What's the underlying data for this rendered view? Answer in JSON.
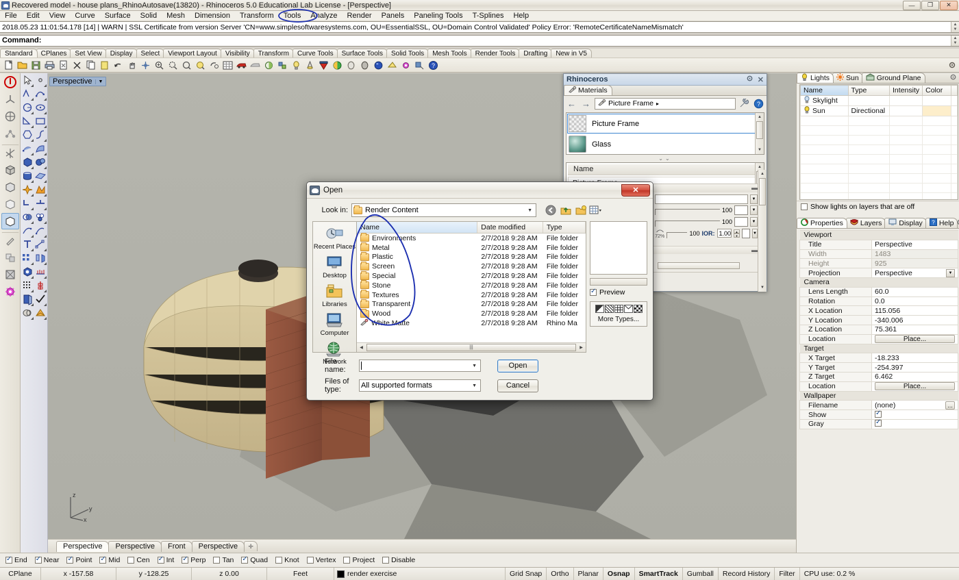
{
  "window": {
    "title": "Recovered model - house plans_RhinoAutosave(13820) - Rhinoceros 5.0 Educational Lab License - [Perspective]",
    "minimize": "—",
    "maximize": "❐",
    "close": "✕"
  },
  "menubar": {
    "items": [
      "File",
      "Edit",
      "View",
      "Curve",
      "Surface",
      "Solid",
      "Mesh",
      "Dimension",
      "Transform",
      "Tools",
      "Analyze",
      "Render",
      "Panels",
      "Paneling Tools",
      "T-Splines",
      "Help"
    ]
  },
  "warning": {
    "text": "2018.05.23 11:01:54.178 [14] | WARN | SSL Certificate from version Server 'CN=www.simplesoftwaresystems.com, OU=EssentialSSL, OU=Domain Control Validated' Policy Error: 'RemoteCertificateNameMismatch'"
  },
  "command": {
    "prompt": "Command:",
    "value": ""
  },
  "toolbar_tabs": {
    "items": [
      "Standard",
      "CPlanes",
      "Set View",
      "Display",
      "Select",
      "Viewport Layout",
      "Visibility",
      "Transform",
      "Curve Tools",
      "Surface Tools",
      "Solid Tools",
      "Mesh Tools",
      "Render Tools",
      "Drafting",
      "New in V5"
    ],
    "active": "Standard"
  },
  "viewport": {
    "label": "Perspective",
    "axis_x": "x",
    "axis_y": "y",
    "axis_z": "z",
    "tabs": [
      "Perspective",
      "Perspective",
      "Front",
      "Perspective"
    ],
    "active_tab_index": 0,
    "add_tab": "✛"
  },
  "materials_panel": {
    "title": "Rhinoceros",
    "gear": "gear-icon",
    "close": "✕",
    "tab": "Materials",
    "back": "←",
    "forward": "→",
    "path": "Picture Frame",
    "path_chevron": "▸",
    "wrench": "wrench-icon",
    "help": "?",
    "list": [
      {
        "name": "Picture Frame",
        "selected": true,
        "swatch": "checker"
      },
      {
        "name": "Glass",
        "selected": false,
        "swatch": "glass-sphere"
      }
    ],
    "name_header": "Name",
    "name_value": "Picture Frame",
    "sliders": [
      {
        "value": "100"
      },
      {
        "value": "100"
      }
    ],
    "transparency_percent": "72%",
    "transparency_value": "100",
    "ior_label": "IOR:",
    "ior_value": "1.00"
  },
  "open_dialog": {
    "title": "Open",
    "close": "✕",
    "look_in_label": "Look in:",
    "look_in_value": "Render Content",
    "nav_icons": [
      "back-icon",
      "up-folder-icon",
      "new-folder-icon",
      "view-mode-icon"
    ],
    "places": [
      {
        "label": "Recent Places",
        "icon": "recent-places-icon"
      },
      {
        "label": "Desktop",
        "icon": "desktop-icon"
      },
      {
        "label": "Libraries",
        "icon": "libraries-icon"
      },
      {
        "label": "Computer",
        "icon": "computer-icon"
      },
      {
        "label": "Network",
        "icon": "network-icon"
      }
    ],
    "columns": [
      "Name",
      "Date modified",
      "Type"
    ],
    "files": [
      {
        "name": "Environments",
        "date": "2/7/2018 9:28 AM",
        "type": "File folder",
        "kind": "folder"
      },
      {
        "name": "Metal",
        "date": "2/7/2018 9:28 AM",
        "type": "File folder",
        "kind": "folder"
      },
      {
        "name": "Plastic",
        "date": "2/7/2018 9:28 AM",
        "type": "File folder",
        "kind": "folder"
      },
      {
        "name": "Screen",
        "date": "2/7/2018 9:28 AM",
        "type": "File folder",
        "kind": "folder"
      },
      {
        "name": "Special",
        "date": "2/7/2018 9:28 AM",
        "type": "File folder",
        "kind": "folder"
      },
      {
        "name": "Stone",
        "date": "2/7/2018 9:28 AM",
        "type": "File folder",
        "kind": "folder"
      },
      {
        "name": "Textures",
        "date": "2/7/2018 9:28 AM",
        "type": "File folder",
        "kind": "folder"
      },
      {
        "name": "Transparent",
        "date": "2/7/2018 9:28 AM",
        "type": "File folder",
        "kind": "folder"
      },
      {
        "name": "Wood",
        "date": "2/7/2018 9:28 AM",
        "type": "File folder",
        "kind": "folder"
      },
      {
        "name": "White Matte",
        "date": "2/7/2018 9:28 AM",
        "type": "Rhino Ma",
        "kind": "material"
      }
    ],
    "preview_label": "Preview",
    "preview_checked": true,
    "more_types": "More Types...",
    "filename_label": "File name:",
    "filename_value": "",
    "filetype_label": "Files of type:",
    "filetype_value": "All supported formats",
    "open_button": "Open",
    "cancel_button": "Cancel"
  },
  "lights_panel": {
    "tabs": [
      {
        "label": "Lights",
        "icon": "lightbulb-icon",
        "active": true
      },
      {
        "label": "Sun",
        "icon": "sun-icon",
        "active": false
      },
      {
        "label": "Ground Plane",
        "icon": "ground-plane-icon",
        "active": false
      }
    ],
    "gear": "gear-icon",
    "columns": [
      "Name",
      "Type",
      "Intensity",
      "Color"
    ],
    "rows": [
      {
        "name": "Skylight",
        "type": "",
        "intensity": "",
        "color": "",
        "icon": "skylight-icon"
      },
      {
        "name": "Sun",
        "type": "Directional",
        "intensity": "",
        "color": "#fdeecb",
        "icon": "sun-bulb-icon"
      }
    ],
    "footer_checkbox": "Show lights on layers that are off",
    "footer_checked": false
  },
  "properties_panel": {
    "tabs": [
      {
        "label": "Properties",
        "icon": "properties-icon",
        "active": true
      },
      {
        "label": "Layers",
        "icon": "layers-icon",
        "active": false
      },
      {
        "label": "Display",
        "icon": "display-icon",
        "active": false
      },
      {
        "label": "Help",
        "icon": "help-icon",
        "active": false
      }
    ],
    "gear": "gear-icon",
    "groups": [
      {
        "title": "Viewport",
        "rows": [
          {
            "label": "Title",
            "value": "Perspective",
            "dim": false,
            "kind": "text"
          },
          {
            "label": "Width",
            "value": "1483",
            "dim": true,
            "kind": "text"
          },
          {
            "label": "Height",
            "value": "925",
            "dim": true,
            "kind": "text"
          },
          {
            "label": "Projection",
            "value": "Perspective",
            "dim": false,
            "kind": "dropdown"
          }
        ]
      },
      {
        "title": "Camera",
        "rows": [
          {
            "label": "Lens Length",
            "value": "60.0",
            "dim": false,
            "kind": "text"
          },
          {
            "label": "Rotation",
            "value": "0.0",
            "dim": false,
            "kind": "text"
          },
          {
            "label": "X Location",
            "value": "115.056",
            "dim": false,
            "kind": "text"
          },
          {
            "label": "Y Location",
            "value": "-340.006",
            "dim": false,
            "kind": "text"
          },
          {
            "label": "Z Location",
            "value": "75.361",
            "dim": false,
            "kind": "text"
          },
          {
            "label": "Location",
            "value": "Place...",
            "dim": false,
            "kind": "button"
          }
        ]
      },
      {
        "title": "Target",
        "rows": [
          {
            "label": "X Target",
            "value": "-18.233",
            "dim": false,
            "kind": "text"
          },
          {
            "label": "Y Target",
            "value": "-254.397",
            "dim": false,
            "kind": "text"
          },
          {
            "label": "Z Target",
            "value": "6.462",
            "dim": false,
            "kind": "text"
          },
          {
            "label": "Location",
            "value": "Place...",
            "dim": false,
            "kind": "button"
          }
        ]
      },
      {
        "title": "Wallpaper",
        "rows": [
          {
            "label": "Filename",
            "value": "(none)",
            "dim": false,
            "kind": "browse"
          },
          {
            "label": "Show",
            "value": "",
            "dim": false,
            "kind": "checkbox",
            "checked": true
          },
          {
            "label": "Gray",
            "value": "",
            "dim": false,
            "kind": "checkbox",
            "checked": true
          }
        ]
      }
    ]
  },
  "osnap_bar": {
    "items": [
      {
        "label": "End",
        "checked": true
      },
      {
        "label": "Near",
        "checked": true
      },
      {
        "label": "Point",
        "checked": true
      },
      {
        "label": "Mid",
        "checked": true
      },
      {
        "label": "Cen",
        "checked": false
      },
      {
        "label": "Int",
        "checked": true
      },
      {
        "label": "Perp",
        "checked": true
      },
      {
        "label": "Tan",
        "checked": false
      },
      {
        "label": "Quad",
        "checked": true
      },
      {
        "label": "Knot",
        "checked": false
      },
      {
        "label": "Vertex",
        "checked": false
      },
      {
        "label": "Project",
        "checked": false
      },
      {
        "label": "Disable",
        "checked": false
      }
    ]
  },
  "status_bar": {
    "cplane": "CPlane",
    "x": "x -157.58",
    "y": "y -128.25",
    "z": "z 0.00",
    "units": "Feet",
    "layer": "render exercise",
    "layer_color": "#000000",
    "toggles": [
      {
        "label": "Grid Snap",
        "active": false
      },
      {
        "label": "Ortho",
        "active": false
      },
      {
        "label": "Planar",
        "active": false
      },
      {
        "label": "Osnap",
        "active": true
      },
      {
        "label": "SmartTrack",
        "active": true
      },
      {
        "label": "Gumball",
        "active": false
      },
      {
        "label": "Record History",
        "active": false
      },
      {
        "label": "Filter",
        "active": false
      }
    ],
    "cpu": "CPU use: 0.2 %"
  }
}
